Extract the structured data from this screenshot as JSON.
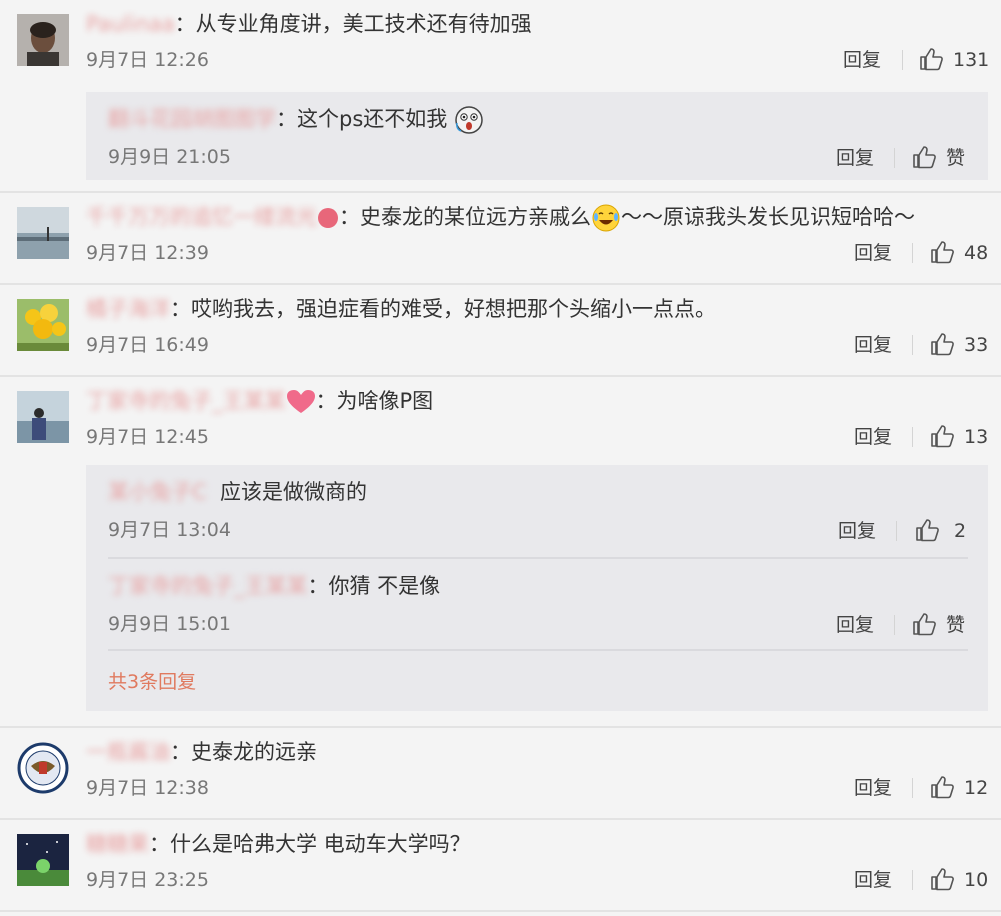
{
  "thumb_icon": "thumbs-up-icon",
  "colors": {
    "accent_more": "#e07a5f",
    "blurred_name": "#e8a3a3",
    "reply_box_bg": "#e9e9ec"
  },
  "comments": [
    {
      "user": "Paulinaa",
      "colon": "：",
      "text": "从专业角度讲，美工技术还有待加强",
      "time": "9月7日 12:26",
      "reply_label": "回复",
      "likes": "131",
      "replies": [
        {
          "user": "翻斗花园胡图图学",
          "colon": "：",
          "text": "这个ps还不如我",
          "emoji": "scream-emoji",
          "time": "9月9日 21:05",
          "reply_label": "回复",
          "likes": "赞"
        }
      ]
    },
    {
      "user": "千千万万的追忆一缕流光",
      "colon": "：",
      "text_before": "史泰龙的某位远方亲戚么",
      "emoji": "laughing-tears-emoji",
      "text_after": "～～原谅我头发长见识短哈哈～",
      "time": "9月7日 12:39",
      "reply_label": "回复",
      "likes": "48"
    },
    {
      "user": "橘子海洋",
      "colon": "：",
      "text": "哎哟我去，强迫症看的难受，好想把那个头缩小一点点。",
      "time": "9月7日 16:49",
      "reply_label": "回复",
      "likes": "33"
    },
    {
      "user": "丁家寺的兔子_王某某",
      "colon": "：",
      "text": "为啥像P图",
      "time": "9月7日 12:45",
      "reply_label": "回复",
      "likes": "13",
      "replies": [
        {
          "user": "某小兔子C",
          "colon": "",
          "text": "应该是做微商的",
          "time": "9月7日 13:04",
          "reply_label": "回复",
          "likes": "2"
        },
        {
          "user": "丁家寺的兔子_王某某",
          "colon": "：",
          "text": "你猜 不是像",
          "time": "9月9日 15:01",
          "reply_label": "回复",
          "likes": "赞"
        }
      ],
      "more_replies": "共3条回复"
    },
    {
      "user": "一瓶酱油",
      "colon": "：",
      "text": "史泰龙的远亲",
      "time": "9月7日 12:38",
      "reply_label": "回复",
      "likes": "12"
    },
    {
      "user": "糖糖果",
      "colon": "：",
      "text": "什么是哈弗大学 电动车大学吗？",
      "time": "9月7日 23:25",
      "reply_label": "回复",
      "likes": "10"
    }
  ]
}
